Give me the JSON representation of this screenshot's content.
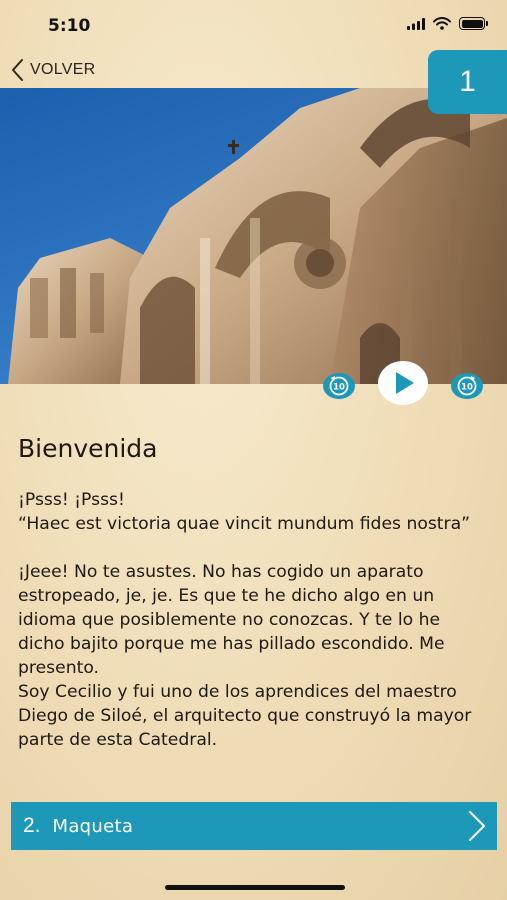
{
  "status_bar": {
    "time": "5:10",
    "battery_level": 1.0
  },
  "nav": {
    "back_label": "VOLVER",
    "back_icon": "chevron-left-icon"
  },
  "stop_number": "1",
  "hero_image": {
    "subject": "Granada Cathedral facade against blue sky"
  },
  "audio": {
    "rewind_icon": "rewind-10-icon",
    "play_icon": "play-icon",
    "forward_icon": "forward-10-icon"
  },
  "content": {
    "title": "Bienvenida",
    "lines": [
      "¡Psss! ¡Psss!",
      "“Haec est victoria quae vincit mundum fides nostra”"
    ],
    "paragraph": [
      "¡Jeee! No te asustes. No has cogido un aparato estropeado, je, je. Es que te he dicho algo en un idioma que posiblemente no conozcas. Y te lo he dicho bajito porque me has pillado escondido. Me presento.",
      "Soy Cecilio y fui uno de los aprendices del maestro Diego de Siloé, el arquitecto que construyó la mayor parte de esta Catedral."
    ]
  },
  "next_section": {
    "number": "2.",
    "title": "Maqueta",
    "icon": "chevron-right-icon"
  },
  "colors": {
    "accent": "#1e98b8",
    "background": "#efdcb6",
    "text": "#1d1915"
  }
}
